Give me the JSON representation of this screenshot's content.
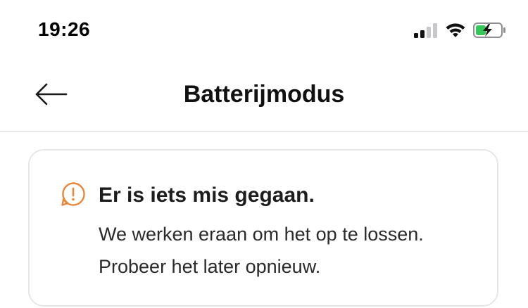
{
  "status_bar": {
    "time": "19:26",
    "signal_icon": "cellular-signal-icon",
    "wifi_icon": "wifi-icon",
    "battery_icon": "battery-charging-icon",
    "battery_color": "#34c759"
  },
  "nav": {
    "back_icon": "arrow-left-icon",
    "title": "Batterijmodus"
  },
  "error": {
    "icon": "alert-speech-bubble-icon",
    "icon_color": "#e8873a",
    "title": "Er is iets mis gegaan.",
    "message": "We werken eraan om het op te lossen. Probeer het later opnieuw."
  }
}
